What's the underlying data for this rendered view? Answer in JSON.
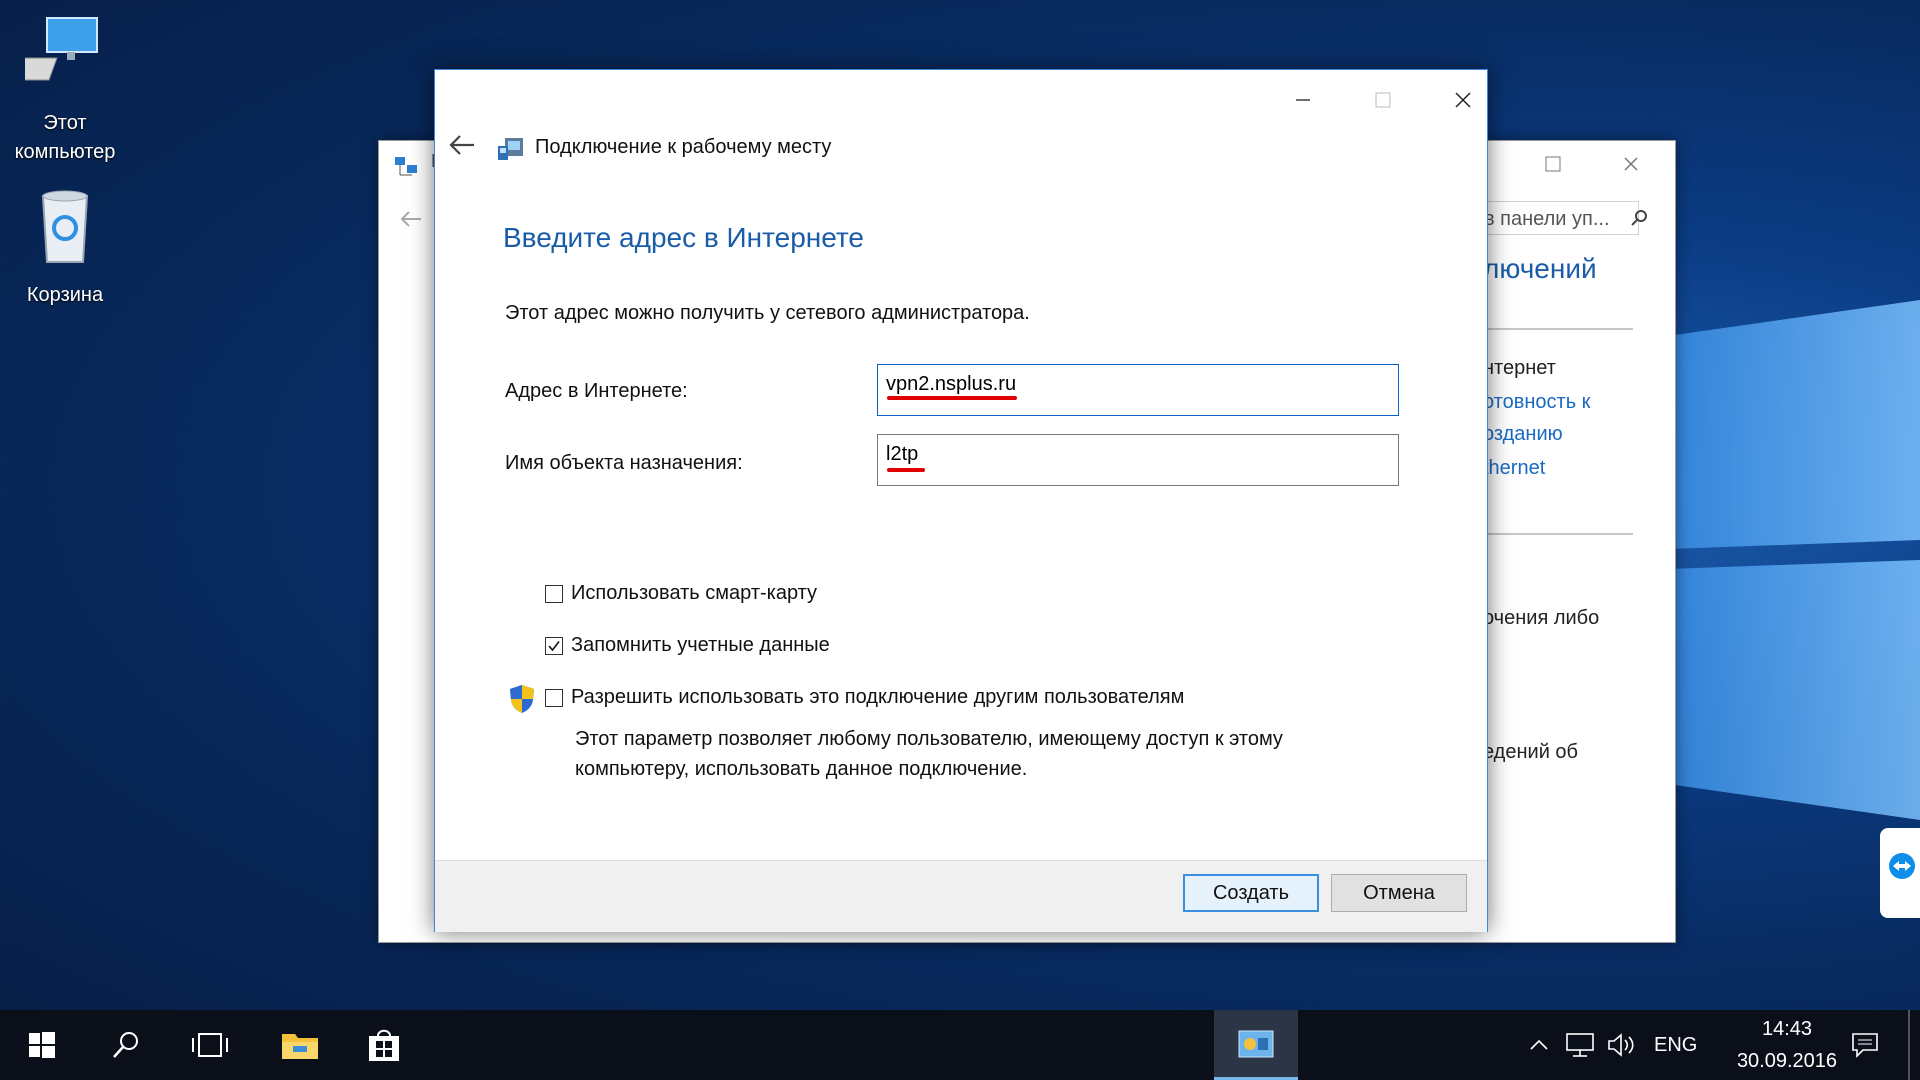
{
  "desktop": {
    "icons": [
      {
        "label_line1": "Этот",
        "label_line2": "компьютер",
        "icon": "computer-icon"
      },
      {
        "label_line1": "Корзина",
        "icon": "recycle-bin-icon"
      }
    ]
  },
  "background_window": {
    "search_placeholder": "в панели уп...",
    "title_fragment": "лючений",
    "text_internet": "нтернет",
    "link_1": "отовность к",
    "link_2": "озданию",
    "link_3": "thernet",
    "text_connect": "очения либо",
    "text_info": "едений об"
  },
  "dialog": {
    "title": "Подключение к рабочему месту",
    "heading": "Введите адрес в Интернете",
    "description": "Этот адрес можно получить у сетевого администратора.",
    "address_label": "Адрес в Интернете:",
    "address_value": "vpn2.nsplus.ru",
    "dest_label": "Имя объекта назначения:",
    "dest_value": "l2tp",
    "smartcard_label": "Использовать смарт-карту",
    "smartcard_checked": false,
    "remember_label": "Запомнить учетные данные",
    "remember_checked": true,
    "allow_label": "Разрешить использовать это подключение другим пользователям",
    "allow_checked": false,
    "allow_note": "Этот параметр позволяет любому пользователю, имеющему доступ к этому компьютеру, использовать данное подключение.",
    "create_button": "Создать",
    "cancel_button": "Отмена"
  },
  "taskbar": {
    "language": "ENG",
    "time": "14:43",
    "date": "30.09.2016"
  },
  "colors": {
    "accent": "#1a5ca8",
    "highlight_underline": "#e00000",
    "taskbar": "#0a0f1a"
  }
}
